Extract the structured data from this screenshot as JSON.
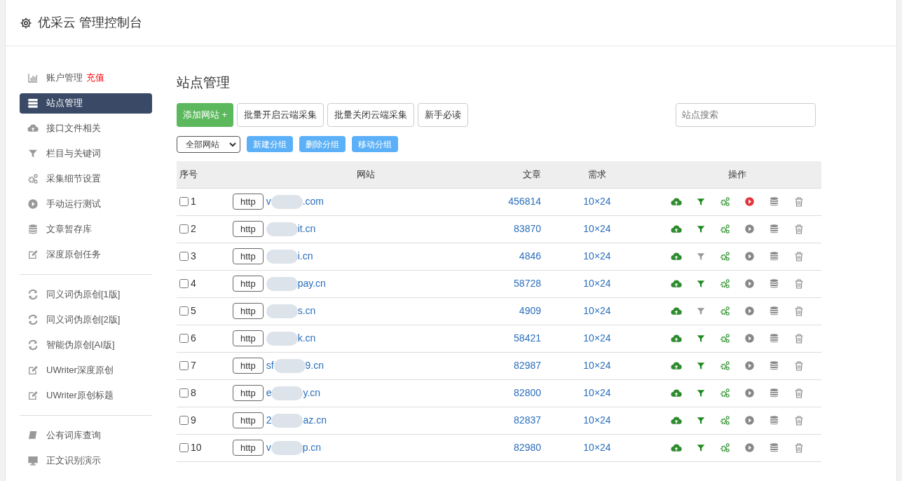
{
  "header": {
    "title": "优采云 管理控制台"
  },
  "sidebar": {
    "groups": [
      [
        {
          "kind": "chart",
          "label": "账户管理",
          "badge": "充值",
          "selected": false
        },
        {
          "kind": "server",
          "label": "站点管理",
          "selected": true
        },
        {
          "kind": "cloud",
          "label": "接口文件相关",
          "selected": false
        },
        {
          "kind": "filter",
          "label": "栏目与关键词",
          "selected": false
        },
        {
          "kind": "gears",
          "label": "采集细节设置",
          "selected": false
        },
        {
          "kind": "play",
          "label": "手动运行测试",
          "selected": false
        },
        {
          "kind": "db",
          "label": "文章暂存库",
          "selected": false
        },
        {
          "kind": "edit",
          "label": "深度原创任务",
          "selected": false
        }
      ],
      [
        {
          "kind": "refresh",
          "label": "同义词伪原创[1版]",
          "selected": false
        },
        {
          "kind": "refresh",
          "label": "同义词伪原创[2版]",
          "selected": false
        },
        {
          "kind": "refresh",
          "label": "智能伪原创[AI版]",
          "selected": false
        },
        {
          "kind": "edit",
          "label": "UWriter深度原创",
          "selected": false
        },
        {
          "kind": "edit",
          "label": "UWriter原创标题",
          "selected": false
        }
      ],
      [
        {
          "kind": "book",
          "label": "公有词库查询",
          "selected": false
        },
        {
          "kind": "monitor",
          "label": "正文识别演示",
          "selected": false
        }
      ]
    ]
  },
  "main": {
    "title": "站点管理",
    "actions": [
      {
        "kind": "primary",
        "label": "添加网站 +"
      },
      {
        "kind": "default",
        "label": "批量开启云端采集"
      },
      {
        "kind": "default",
        "label": "批量关闭云端采集"
      },
      {
        "kind": "default",
        "label": "新手必读"
      }
    ],
    "search": {
      "placeholder": "站点搜索"
    },
    "group_select": "全部网站",
    "group_actions": [
      "新建分组",
      "删除分组",
      "移动分组"
    ],
    "table": {
      "columns": [
        "序号",
        "网站",
        "文章",
        "需求",
        "操作"
      ],
      "rows": [
        {
          "no": "1",
          "checked": false,
          "scheme": "http",
          "head": "v",
          "tail": ".com",
          "articles": "456814",
          "demand": "10×24",
          "filter_on": true,
          "running": true
        },
        {
          "no": "2",
          "checked": false,
          "scheme": "http",
          "head": "",
          "tail": "it.cn",
          "articles": "83870",
          "demand": "10×24",
          "filter_on": true,
          "running": false
        },
        {
          "no": "3",
          "checked": false,
          "scheme": "http",
          "head": "",
          "tail": "i.cn",
          "articles": "4846",
          "demand": "10×24",
          "filter_on": false,
          "running": false
        },
        {
          "no": "4",
          "checked": false,
          "scheme": "http",
          "head": "",
          "tail": "pay.cn",
          "articles": "58728",
          "demand": "10×24",
          "filter_on": true,
          "running": false
        },
        {
          "no": "5",
          "checked": false,
          "scheme": "http",
          "head": "",
          "tail": "s.cn",
          "articles": "4909",
          "demand": "10×24",
          "filter_on": false,
          "running": false
        },
        {
          "no": "6",
          "checked": false,
          "scheme": "http",
          "head": "",
          "tail": "k.cn",
          "articles": "58421",
          "demand": "10×24",
          "filter_on": true,
          "running": false
        },
        {
          "no": "7",
          "checked": false,
          "scheme": "http",
          "head": "sf",
          "tail": "9.cn",
          "articles": "82987",
          "demand": "10×24",
          "filter_on": true,
          "running": false
        },
        {
          "no": "8",
          "checked": false,
          "scheme": "http",
          "head": "e",
          "tail": "y.cn",
          "articles": "82800",
          "demand": "10×24",
          "filter_on": true,
          "running": false
        },
        {
          "no": "9",
          "checked": false,
          "scheme": "http",
          "head": "2",
          "tail": "az.cn",
          "articles": "82837",
          "demand": "10×24",
          "filter_on": true,
          "running": false
        },
        {
          "no": "10",
          "checked": false,
          "scheme": "http",
          "head": "v",
          "tail": "p.cn",
          "articles": "82980",
          "demand": "10×24",
          "filter_on": true,
          "running": false
        }
      ]
    }
  }
}
